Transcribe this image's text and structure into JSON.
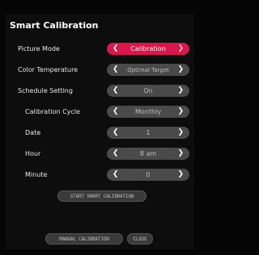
{
  "title": "Smart Calibration",
  "rows": [
    {
      "label": "Picture Mode",
      "value": "Calibration"
    },
    {
      "label": "Color Temperature",
      "value": "Optimal Target"
    },
    {
      "label": "Schedule Setting",
      "value": "On"
    },
    {
      "label": "Calibration Cycle",
      "value": "Monthly"
    },
    {
      "label": "Date",
      "value": "1"
    },
    {
      "label": "Hour",
      "value": "8 am"
    },
    {
      "label": "Minute",
      "value": "0"
    }
  ],
  "buttons": {
    "start": "START SMART CALIBRATION",
    "manual": "MANUAL CALIBRATION",
    "close": "CLOSE"
  },
  "arrows": {
    "left": "❮",
    "right": "❯"
  },
  "colors": {
    "active": "#d8174f",
    "control": "#4a4a4a",
    "background": "#0d0d0d"
  }
}
